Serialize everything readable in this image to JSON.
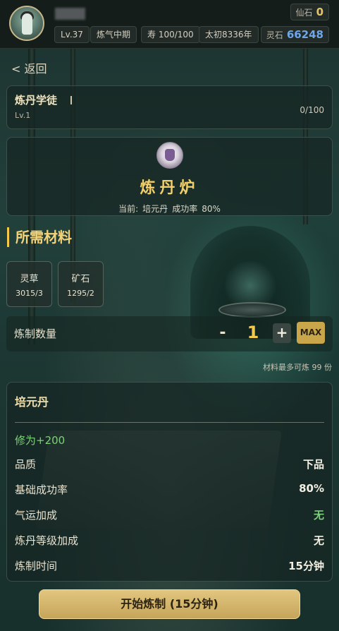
{
  "header": {
    "level": "Lv.37",
    "realm": "炼气中期",
    "lifespan": "寿 100/100",
    "era": "太初8336年",
    "currencies": {
      "xianshi_label": "仙石",
      "xianshi_value": "0",
      "lingshi_label": "灵石",
      "lingshi_value": "66248"
    }
  },
  "nav": {
    "back_label": "< 返回"
  },
  "rank": {
    "title": "炼丹学徒",
    "level": "Lv.1",
    "progress": "0/100",
    "progress_fraction": 0.0
  },
  "furnace": {
    "title": "炼丹炉",
    "current_prefix": "当前:",
    "current_pill": "培元丹",
    "success_label": "成功率",
    "success_value": "80%"
  },
  "materials": {
    "title": "所需材料",
    "items": [
      {
        "name": "灵草",
        "count": "3015/3"
      },
      {
        "name": "矿石",
        "count": "1295/2"
      }
    ]
  },
  "quantity": {
    "label": "炼制数量",
    "minus": "-",
    "value": "1",
    "plus": "+",
    "max": "MAX",
    "max_hint": "材料最多可炼 99 份"
  },
  "pill": {
    "name": "培元丹",
    "effect": "修为+200",
    "rows": [
      {
        "key": "品质",
        "value": "下品",
        "color": "#f3efe2"
      },
      {
        "key": "基础成功率",
        "value": "80%",
        "color": "#f3efe2"
      },
      {
        "key": "气运加成",
        "value": "无",
        "color": "#7ed07a"
      },
      {
        "key": "炼丹等级加成",
        "value": "无",
        "color": "#f3efe2"
      },
      {
        "key": "炼制时间",
        "value": "15分钟",
        "color": "#f3efe2"
      }
    ]
  },
  "action": {
    "start_label": "开始炼制 (15分钟)"
  },
  "colors": {
    "accent_gold": "#f2c94c",
    "lingshi_blue": "#6ea7e8",
    "positive_green": "#7ed07a"
  }
}
